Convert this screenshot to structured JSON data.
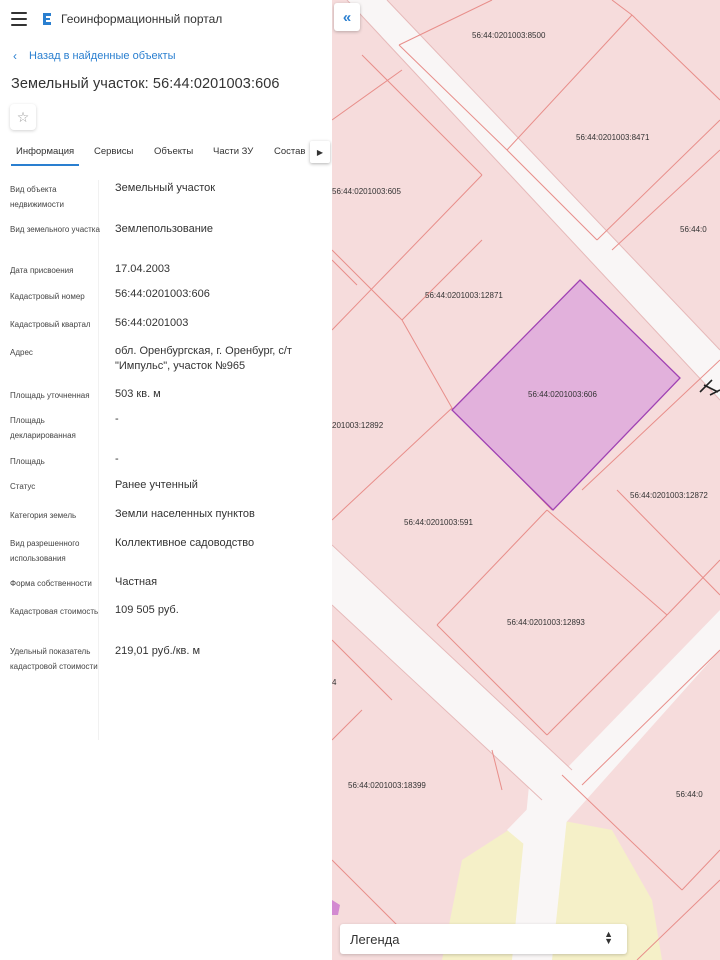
{
  "header": {
    "title": "Геоинформационный портал"
  },
  "back_link": {
    "label": "Назад в найденные объекты"
  },
  "object": {
    "title": "Земельный участок: 56:44:0201003:606"
  },
  "tabs": [
    {
      "label": "Информация",
      "active": true
    },
    {
      "label": "Сервисы"
    },
    {
      "label": "Объекты"
    },
    {
      "label": "Части ЗУ"
    },
    {
      "label": "Состав"
    }
  ],
  "properties": [
    {
      "label": "Вид объекта недвижимости",
      "value": "Земельный участок"
    },
    {
      "label": "Вид земельного участка",
      "value": "Землепользование"
    },
    {
      "label": "Дата присвоения",
      "value": "17.04.2003"
    },
    {
      "label": "Кадастровый номер",
      "value": "56:44:0201003:606"
    },
    {
      "label": "Кадастровый квартал",
      "value": "56:44:0201003"
    },
    {
      "label": "Адрес",
      "value": "обл. Оренбургская, г. Оренбург, с/т \"Импульс\", участок №965"
    },
    {
      "label": "Площадь уточненная",
      "value": "503 кв. м"
    },
    {
      "label": "Площадь декларированная",
      "value": "-"
    },
    {
      "label": "Площадь",
      "value": "-"
    },
    {
      "label": "Статус",
      "value": "Ранее учтенный"
    },
    {
      "label": "Категория земель",
      "value": "Земли населенных пунктов"
    },
    {
      "label": "Вид разрешенного использования",
      "value": "Коллективное садоводство"
    },
    {
      "label": "Форма собственности",
      "value": "Частная"
    },
    {
      "label": "Кадастровая стоимость",
      "value": "109 505 руб."
    },
    {
      "label": "Удельный показатель кадастровой стоимости",
      "value": "219,01 руб./кв. м"
    }
  ],
  "map": {
    "parcel_labels": [
      "56:44:0201003:8500",
      "56:44:0201003:8471",
      "56:44:0201003:605",
      "56:44:0",
      "56:44:0201003:12871",
      "56:44:0201003:606",
      "201003:12892",
      "56:44:0201003:12872",
      "56:44:0201003:591",
      "56:44:0201003:12893",
      "4",
      "56:44:0201003:18399",
      "56:44:0"
    ],
    "colors": {
      "background": "#f6dcdc",
      "boundary": "#e88e8a",
      "selected_fill": "#e2b1dc",
      "selected_stroke": "#a042b3",
      "road": "#f8f8f8",
      "yellow": "#f5f0c8"
    }
  },
  "legend": {
    "label": "Легенда"
  },
  "icons": [
    "menu-icon",
    "portal-logo-icon",
    "chevron-left-icon",
    "star-icon",
    "chevron-right-icon",
    "double-chevron-left-icon",
    "up-down-icon"
  ]
}
